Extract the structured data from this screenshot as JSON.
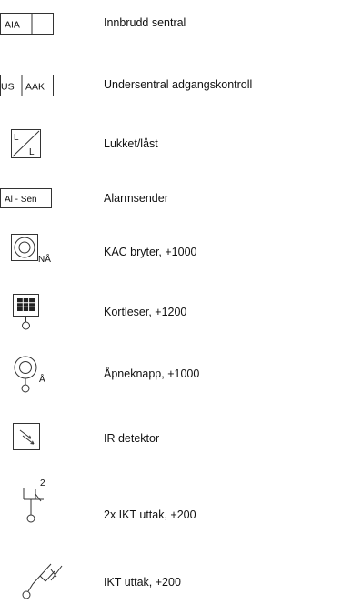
{
  "legend": {
    "items": [
      {
        "symbol": "box-split",
        "symbol_text": "AIA",
        "label": "Innbrudd sentral"
      },
      {
        "symbol": "box-two-cells",
        "symbol_text_left": "US",
        "symbol_text_right": "AAK",
        "label": "Undersentral adgangskontroll"
      },
      {
        "symbol": "box-diagonal",
        "symbol_text_top": "L",
        "symbol_text_bottom": "L",
        "label": "Lukket/låst"
      },
      {
        "symbol": "box-text",
        "symbol_text": "Al - Sen",
        "label": "Alarmsender"
      },
      {
        "symbol": "double-circle-square",
        "symbol_text": "NÅ",
        "label": "KAC bryter, +1000"
      },
      {
        "symbol": "card-reader",
        "label": "Kortleser, +1200"
      },
      {
        "symbol": "double-circle-stem",
        "symbol_text": "Å",
        "label": "Åpneknapp, +1000"
      },
      {
        "symbol": "ir-detector",
        "label": "IR detektor"
      },
      {
        "symbol": "ikt-outlet-double",
        "symbol_text": "2",
        "label": "2x IKT uttak, +200"
      },
      {
        "symbol": "ikt-outlet",
        "label": "IKT uttak, +200"
      }
    ]
  }
}
